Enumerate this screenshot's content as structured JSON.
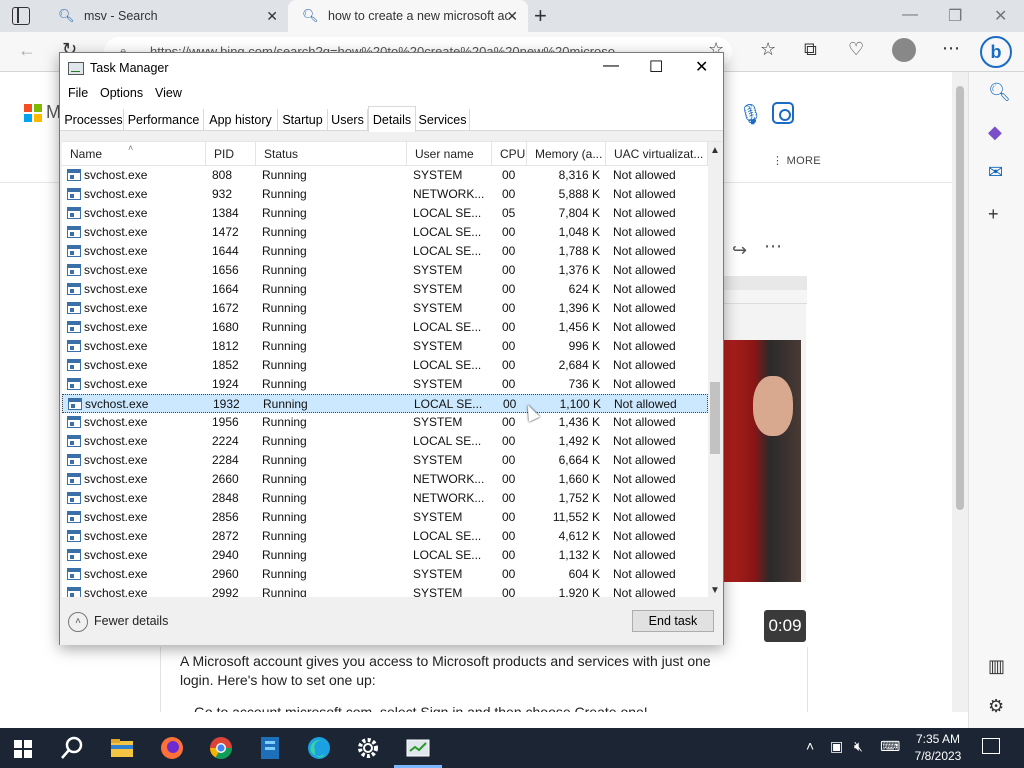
{
  "browser": {
    "tabs": [
      {
        "label": "msv - Search"
      },
      {
        "label": "how to create a new microsoft acc"
      }
    ],
    "url": "https://www.bing.com/search?q=how%20to%20create%20a%20new%20microso"
  },
  "bing_page": {
    "logo_letter": "M",
    "more_label": "MORE",
    "timecode": "0:09",
    "article_text": "A Microsoft account gives you access to Microsoft products and services with just one login. Here's how to set one up:",
    "article_text2": "Go to account.microsoft.com, select Sign in and then choose Create one!"
  },
  "task_manager": {
    "title": "Task Manager",
    "menu": [
      "File",
      "Options",
      "View"
    ],
    "tabs": [
      "Processes",
      "Performance",
      "App history",
      "Startup",
      "Users",
      "Details",
      "Services"
    ],
    "active_tab": "Details",
    "columns": [
      "Name",
      "PID",
      "Status",
      "User name",
      "CPU",
      "Memory (a...",
      "UAC virtualizat..."
    ],
    "selected_pid": "1932",
    "rows": [
      {
        "name": "svchost.exe",
        "pid": "808",
        "status": "Running",
        "user": "SYSTEM",
        "cpu": "00",
        "memory": "8,316 K",
        "uac": "Not allowed"
      },
      {
        "name": "svchost.exe",
        "pid": "932",
        "status": "Running",
        "user": "NETWORK...",
        "cpu": "00",
        "memory": "5,888 K",
        "uac": "Not allowed"
      },
      {
        "name": "svchost.exe",
        "pid": "1384",
        "status": "Running",
        "user": "LOCAL SE...",
        "cpu": "05",
        "memory": "7,804 K",
        "uac": "Not allowed"
      },
      {
        "name": "svchost.exe",
        "pid": "1472",
        "status": "Running",
        "user": "LOCAL SE...",
        "cpu": "00",
        "memory": "1,048 K",
        "uac": "Not allowed"
      },
      {
        "name": "svchost.exe",
        "pid": "1644",
        "status": "Running",
        "user": "LOCAL SE...",
        "cpu": "00",
        "memory": "1,788 K",
        "uac": "Not allowed"
      },
      {
        "name": "svchost.exe",
        "pid": "1656",
        "status": "Running",
        "user": "SYSTEM",
        "cpu": "00",
        "memory": "1,376 K",
        "uac": "Not allowed"
      },
      {
        "name": "svchost.exe",
        "pid": "1664",
        "status": "Running",
        "user": "SYSTEM",
        "cpu": "00",
        "memory": "624 K",
        "uac": "Not allowed"
      },
      {
        "name": "svchost.exe",
        "pid": "1672",
        "status": "Running",
        "user": "SYSTEM",
        "cpu": "00",
        "memory": "1,396 K",
        "uac": "Not allowed"
      },
      {
        "name": "svchost.exe",
        "pid": "1680",
        "status": "Running",
        "user": "LOCAL SE...",
        "cpu": "00",
        "memory": "1,456 K",
        "uac": "Not allowed"
      },
      {
        "name": "svchost.exe",
        "pid": "1812",
        "status": "Running",
        "user": "SYSTEM",
        "cpu": "00",
        "memory": "996 K",
        "uac": "Not allowed"
      },
      {
        "name": "svchost.exe",
        "pid": "1852",
        "status": "Running",
        "user": "LOCAL SE...",
        "cpu": "00",
        "memory": "2,684 K",
        "uac": "Not allowed"
      },
      {
        "name": "svchost.exe",
        "pid": "1924",
        "status": "Running",
        "user": "SYSTEM",
        "cpu": "00",
        "memory": "736 K",
        "uac": "Not allowed"
      },
      {
        "name": "svchost.exe",
        "pid": "1932",
        "status": "Running",
        "user": "LOCAL SE...",
        "cpu": "00",
        "memory": "1,100 K",
        "uac": "Not allowed"
      },
      {
        "name": "svchost.exe",
        "pid": "1956",
        "status": "Running",
        "user": "SYSTEM",
        "cpu": "00",
        "memory": "1,436 K",
        "uac": "Not allowed"
      },
      {
        "name": "svchost.exe",
        "pid": "2224",
        "status": "Running",
        "user": "LOCAL SE...",
        "cpu": "00",
        "memory": "1,492 K",
        "uac": "Not allowed"
      },
      {
        "name": "svchost.exe",
        "pid": "2284",
        "status": "Running",
        "user": "SYSTEM",
        "cpu": "00",
        "memory": "6,664 K",
        "uac": "Not allowed"
      },
      {
        "name": "svchost.exe",
        "pid": "2660",
        "status": "Running",
        "user": "NETWORK...",
        "cpu": "00",
        "memory": "1,660 K",
        "uac": "Not allowed"
      },
      {
        "name": "svchost.exe",
        "pid": "2848",
        "status": "Running",
        "user": "NETWORK...",
        "cpu": "00",
        "memory": "1,752 K",
        "uac": "Not allowed"
      },
      {
        "name": "svchost.exe",
        "pid": "2856",
        "status": "Running",
        "user": "SYSTEM",
        "cpu": "00",
        "memory": "11,552 K",
        "uac": "Not allowed"
      },
      {
        "name": "svchost.exe",
        "pid": "2872",
        "status": "Running",
        "user": "LOCAL SE...",
        "cpu": "00",
        "memory": "4,612 K",
        "uac": "Not allowed"
      },
      {
        "name": "svchost.exe",
        "pid": "2940",
        "status": "Running",
        "user": "LOCAL SE...",
        "cpu": "00",
        "memory": "1,132 K",
        "uac": "Not allowed"
      },
      {
        "name": "svchost.exe",
        "pid": "2960",
        "status": "Running",
        "user": "SYSTEM",
        "cpu": "00",
        "memory": "604 K",
        "uac": "Not allowed"
      },
      {
        "name": "svchost.exe",
        "pid": "2992",
        "status": "Running",
        "user": "SYSTEM",
        "cpu": "00",
        "memory": "1,920 K",
        "uac": "Not allowed"
      }
    ],
    "fewer_details": "Fewer details",
    "end_task": "End task"
  },
  "taskbar": {
    "time": "7:35 AM",
    "date": "7/8/2023"
  }
}
